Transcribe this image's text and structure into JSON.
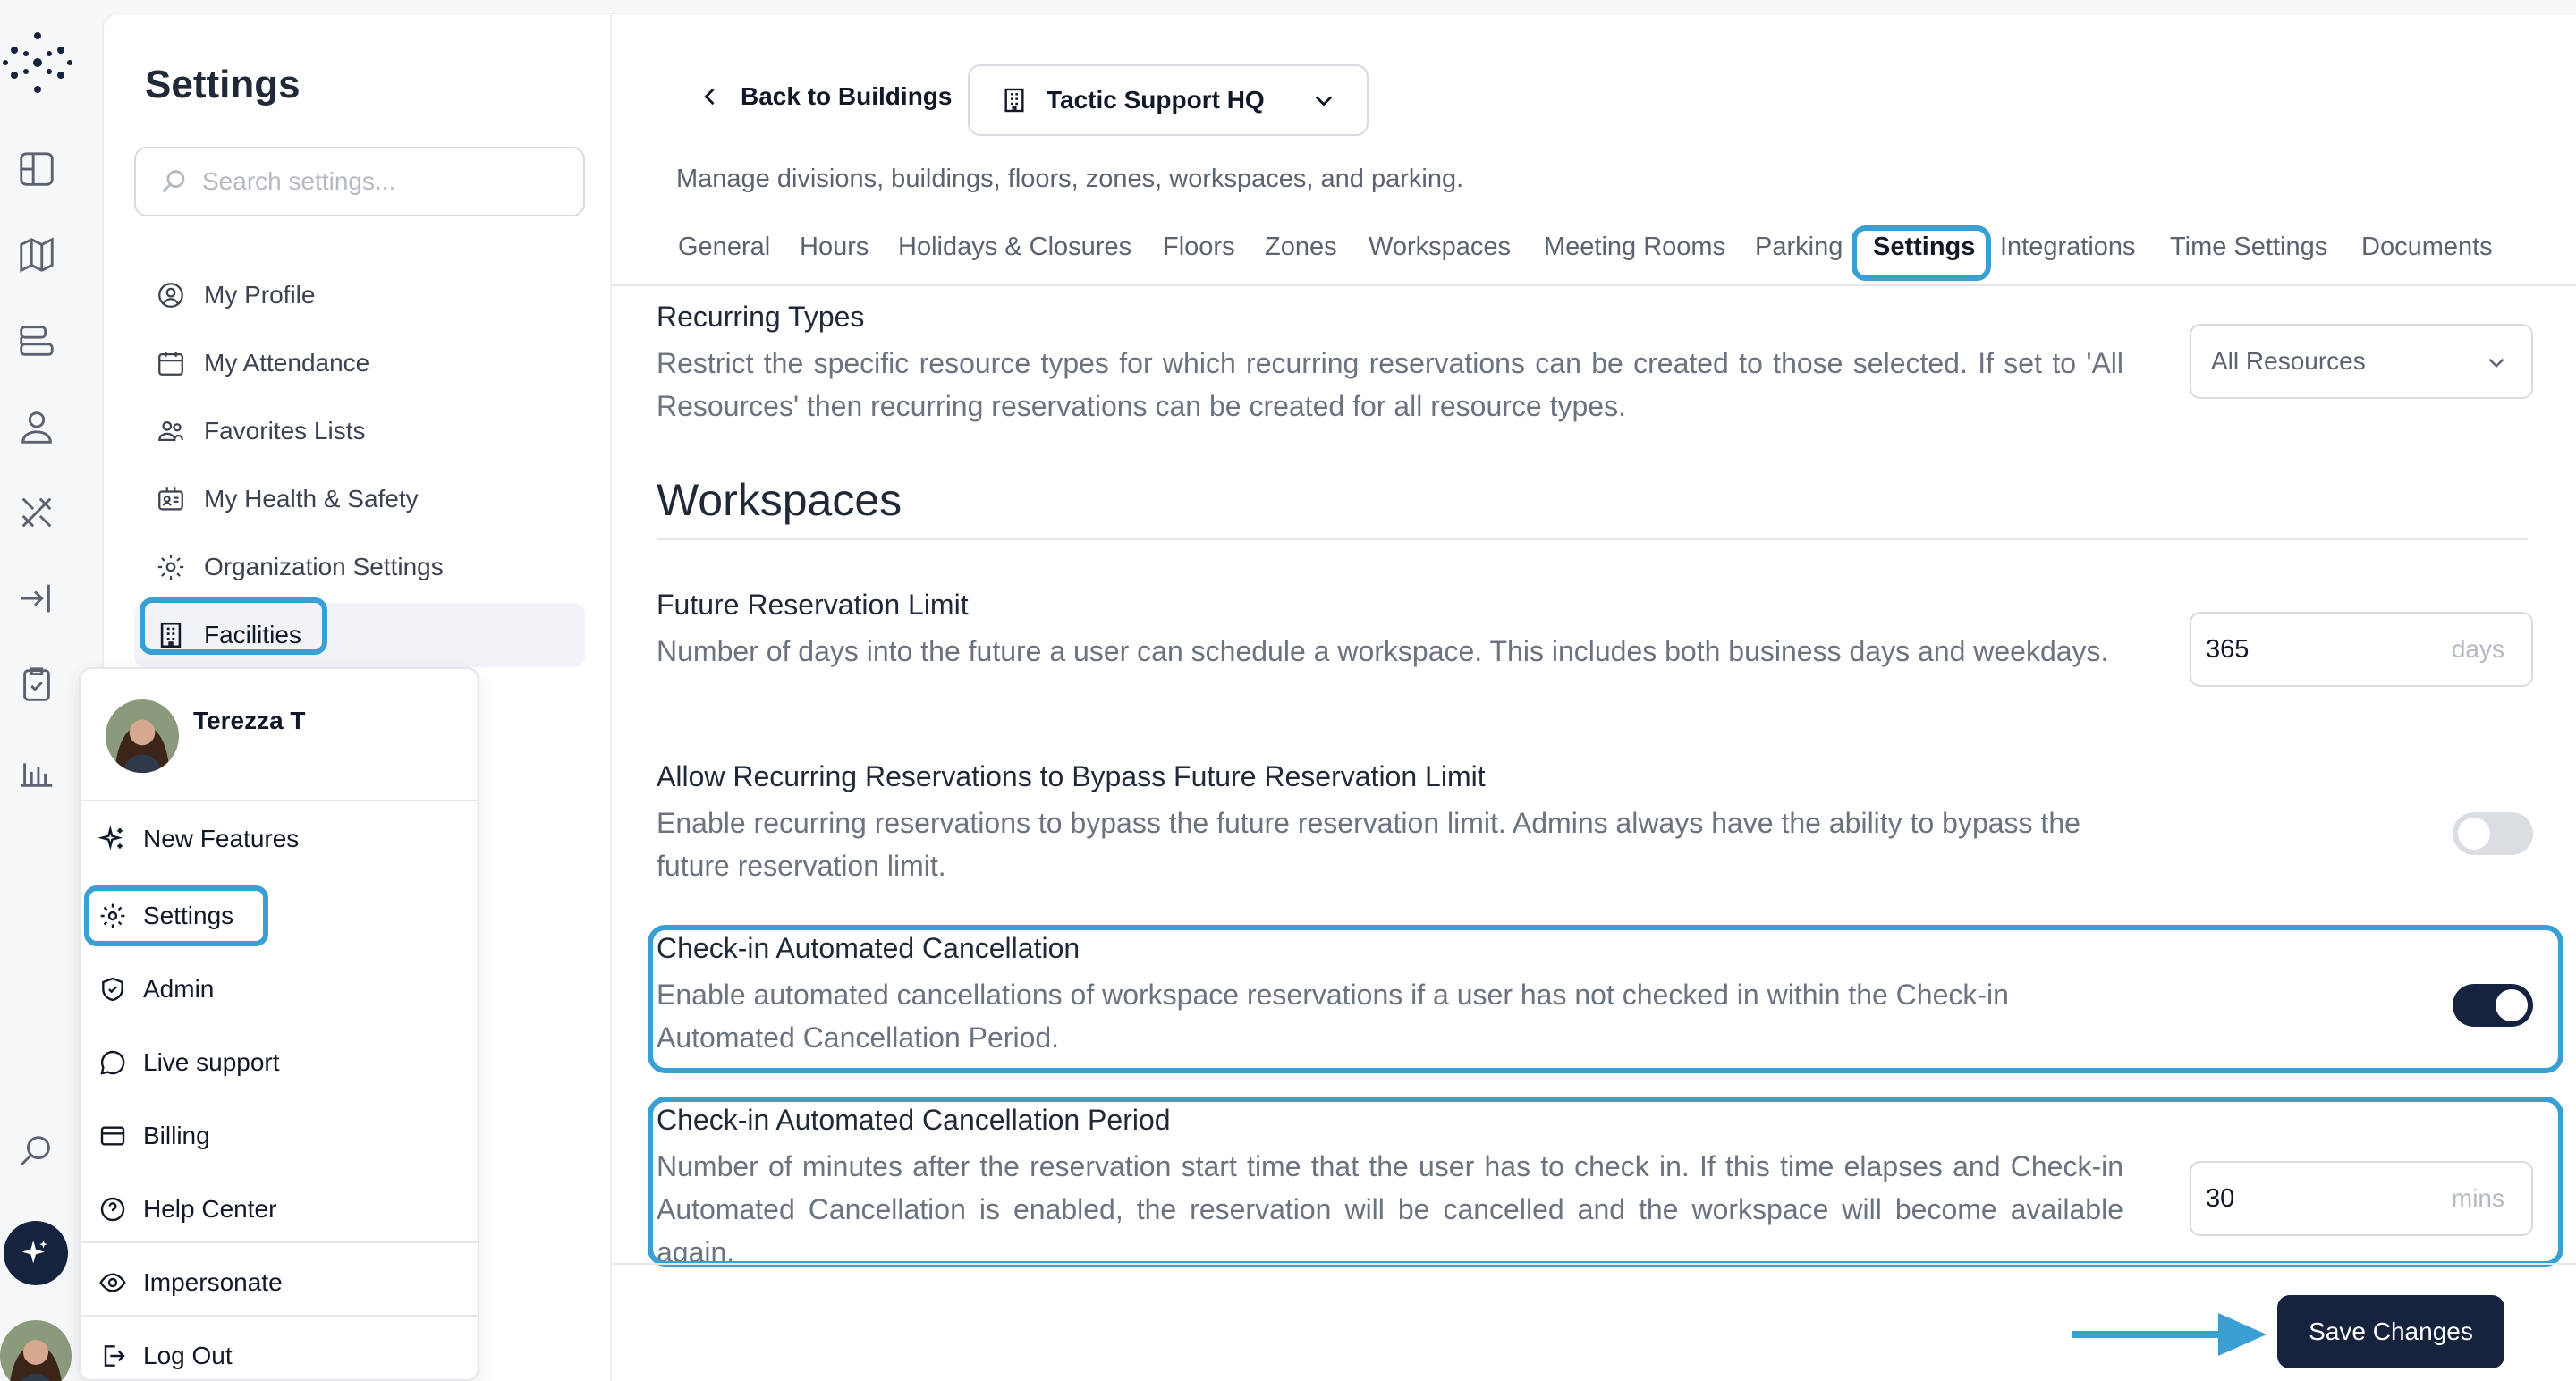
{
  "colors": {
    "accent": "#3aa0d4",
    "navy": "#15233f",
    "toggle_off": "#dadde2"
  },
  "rail": {
    "icons": [
      "layout-icon",
      "map-icon",
      "resources-icon",
      "user-icon",
      "tools-icon",
      "sign-in-icon",
      "checklist-icon",
      "analytics-icon",
      "search-icon"
    ]
  },
  "sidebar": {
    "title": "Settings",
    "search_placeholder": "Search settings...",
    "items": [
      {
        "label": "My Profile",
        "icon": "user-circle-icon"
      },
      {
        "label": "My Attendance",
        "icon": "calendar-icon"
      },
      {
        "label": "Favorites Lists",
        "icon": "people-icon"
      },
      {
        "label": "My Health & Safety",
        "icon": "id-card-icon"
      },
      {
        "label": "Organization Settings",
        "icon": "gear-icon"
      },
      {
        "label": "Facilities",
        "icon": "building-icon",
        "active": true
      }
    ]
  },
  "header": {
    "back_label": "Back to Buildings",
    "building": "Tactic Support HQ",
    "subtitle": "Manage divisions, buildings, floors, zones, workspaces, and parking."
  },
  "tabs": [
    "General",
    "Hours",
    "Holidays & Closures",
    "Floors",
    "Zones",
    "Workspaces",
    "Meeting Rooms",
    "Parking",
    "Settings",
    "Integrations",
    "Time Settings",
    "Documents"
  ],
  "active_tab": "Settings",
  "recurring": {
    "title": "Recurring Types",
    "desc": "Restrict the specific resource types for which recurring reservations can be created to those selected. If set to 'All Resources' then recurring reservations can be created for all resource types.",
    "value": "All Resources"
  },
  "workspaces": {
    "heading": "Workspaces",
    "future_limit": {
      "title": "Future Reservation Limit",
      "desc": "Number of days into the future a user can schedule a workspace. This includes both business days and weekdays.",
      "value": "365",
      "unit": "days"
    },
    "bypass": {
      "title": "Allow Recurring Reservations to Bypass Future Reservation Limit",
      "desc": "Enable recurring reservations to bypass the future reservation limit. Admins always have the ability to bypass the future reservation limit.",
      "enabled": false
    },
    "auto_cancel": {
      "title": "Check-in Automated Cancellation",
      "desc": "Enable automated cancellations of workspace reservations if a user has not checked in within the Check-in Automated Cancellation Period.",
      "enabled": true
    },
    "cancel_period": {
      "title": "Check-in Automated Cancellation Period",
      "desc": "Number of minutes after the reservation start time that the user has to check in. If this time elapses and Check-in Automated Cancellation is enabled, the reservation will be cancelled and the workspace will become available again.",
      "value": "30",
      "unit": "mins"
    }
  },
  "save_label": "Save Changes",
  "user_menu": {
    "name": "Terezza T",
    "items": [
      {
        "label": "New Features",
        "icon": "sparkle-icon"
      },
      {
        "label": "Settings",
        "icon": "gear-icon"
      },
      {
        "label": "Admin",
        "icon": "shield-icon"
      },
      {
        "label": "Live support",
        "icon": "chat-icon"
      },
      {
        "label": "Billing",
        "icon": "credit-card-icon"
      },
      {
        "label": "Help Center",
        "icon": "help-icon"
      },
      {
        "label": "Impersonate",
        "icon": "eye-icon"
      },
      {
        "label": "Log Out",
        "icon": "logout-icon"
      }
    ]
  }
}
